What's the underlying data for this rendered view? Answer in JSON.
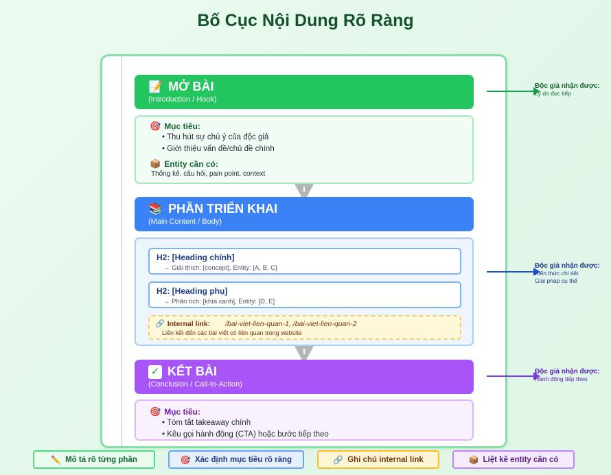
{
  "title": "Bố Cục Nội Dung Rõ Ràng",
  "colors": {
    "green": "#22c55e",
    "blue": "#3b82f6",
    "purple": "#a855f7"
  },
  "intro": {
    "icon": "memo-icon",
    "title": "MỞ BÀI",
    "subtitle": "(Introduction / Hook)",
    "goal_label": "Mục tiêu:",
    "goals": [
      "• Thu hút sự chú ý của độc giả",
      "• Giới thiệu vấn đề/chủ đề chính"
    ],
    "entity_label": "Entity cần có:",
    "entity_text": "Thống kê, câu hỏi, pain point, context"
  },
  "body": {
    "icon": "books-icon",
    "title": "PHẦN TRIỂN KHAI",
    "subtitle": "(Main Content / Body)",
    "h2_main": "H2: [Heading chính]",
    "h2_main_desc": "→ Giải thích: [concept], Entity: [A, B, C]",
    "h2_sub": "H2: [Heading phụ]",
    "h2_sub_desc": "→ Phân tích: [khía cạnh], Entity: [D, E]",
    "link_label": "Internal link:",
    "link_paths": "/bai-viet-lien-quan-1, /bai-viet-lien-quan-2",
    "link_desc": "Liên kết đến các bài viết có liên quan trong website"
  },
  "conclusion": {
    "icon": "check-icon",
    "title": "KẾT BÀI",
    "subtitle": "(Conclusion / Call-to-Action)",
    "goal_label": "Mục tiêu:",
    "goals": [
      "• Tóm tắt takeaway chính",
      "• Kêu gọi hành động (CTA) hoặc bước tiếp theo"
    ]
  },
  "side_notes": [
    {
      "title": "Độc giả nhận được:",
      "lines": [
        "Lý do đọc tiếp"
      ]
    },
    {
      "title": "Độc giả nhận được:",
      "lines": [
        "Kiến thức chi tiết",
        "Giải pháp cụ thể"
      ]
    },
    {
      "title": "Độc giả nhận được:",
      "lines": [
        "Hành động tiếp theo"
      ]
    }
  ],
  "legend": [
    {
      "icon": "pencil-icon",
      "label": "Mô tả rõ từng phần"
    },
    {
      "icon": "target-icon",
      "label": "Xác định mục tiêu rõ ràng"
    },
    {
      "icon": "link-icon",
      "label": "Ghi chú internal link"
    },
    {
      "icon": "box-icon",
      "label": "Liệt kê entity cần có"
    }
  ]
}
